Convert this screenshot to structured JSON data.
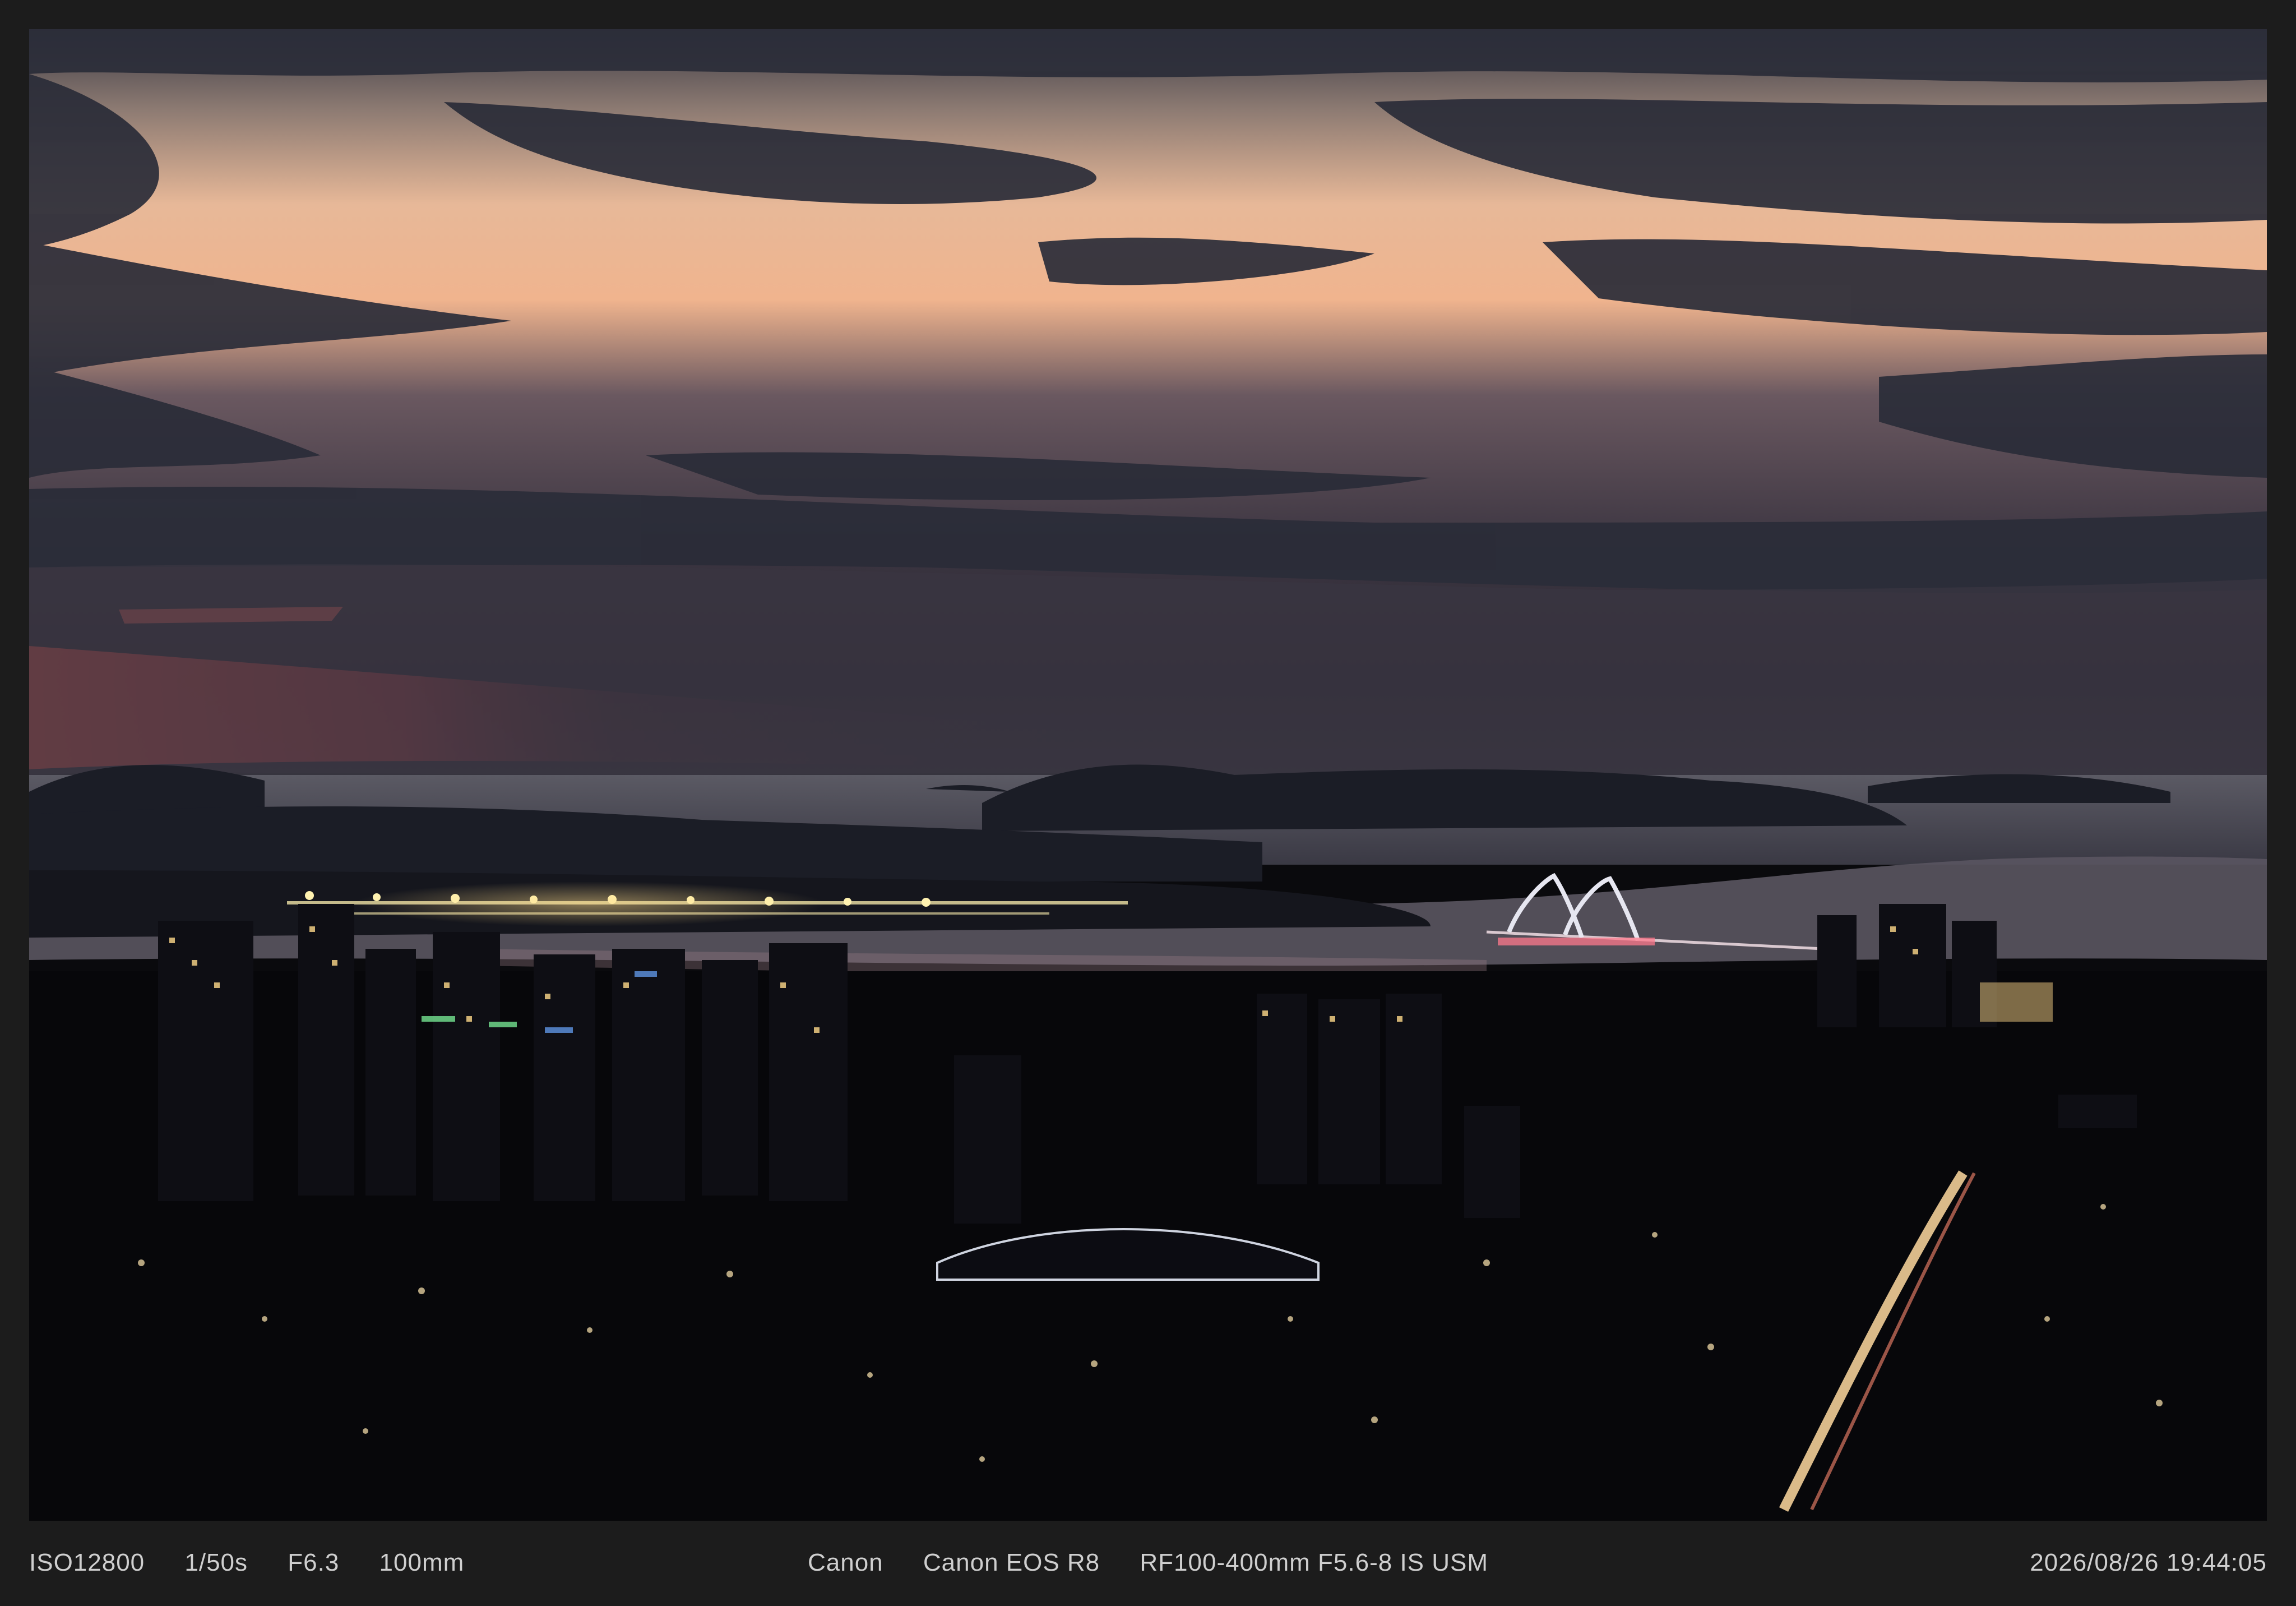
{
  "photo": {
    "subject": "city-skyline-at-dusk-photo"
  },
  "exif": {
    "iso": "ISO12800",
    "shutter": "1/50s",
    "aperture": "F6.3",
    "focal_length": "100mm",
    "brand": "Canon",
    "camera": "Canon EOS R8",
    "lens": "RF100-400mm F5.6-8 IS USM",
    "datetime": "2026/08/26 19:44:05"
  }
}
